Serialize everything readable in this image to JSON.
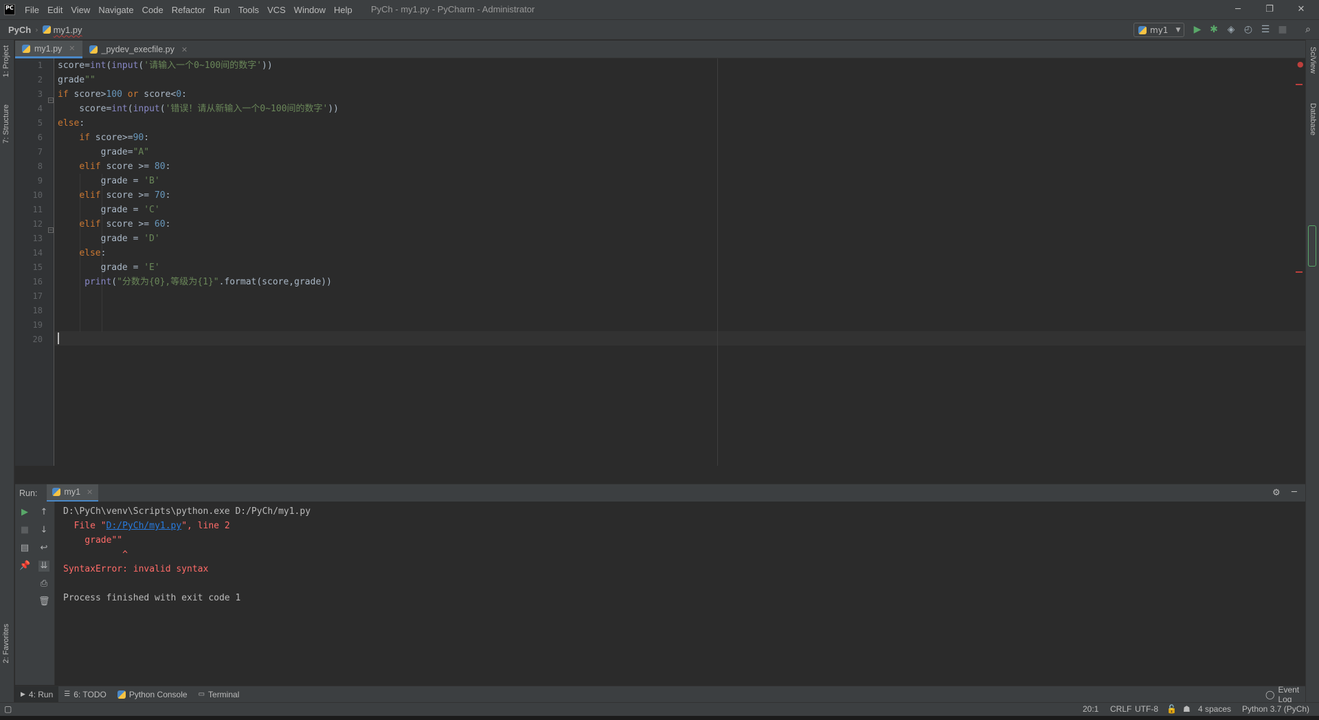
{
  "app": {
    "logo_text": "PC",
    "window_title": "PyCh - my1.py - PyCharm - Administrator"
  },
  "menu": [
    "File",
    "Edit",
    "View",
    "Navigate",
    "Code",
    "Refactor",
    "Run",
    "Tools",
    "VCS",
    "Window",
    "Help"
  ],
  "breadcrumb": {
    "project": "PyCh",
    "file": "my1.py"
  },
  "run_config": {
    "name": "my1"
  },
  "left_tabs": {
    "project": "1: Project",
    "structure": "7: Structure",
    "favorites": "2: Favorites"
  },
  "right_tabs": {
    "sciview": "SciView",
    "database": "Database"
  },
  "editor_tabs": [
    {
      "label": "my1.py",
      "active": true
    },
    {
      "label": "_pydev_execfile.py",
      "active": false
    }
  ],
  "editor": {
    "line_numbers": [
      "1",
      "2",
      "3",
      "4",
      "5",
      "6",
      "7",
      "8",
      "9",
      "10",
      "11",
      "12",
      "13",
      "14",
      "15",
      "16",
      "17",
      "18",
      "19",
      "20"
    ],
    "lines": [
      [
        [
          "",
          "score="
        ],
        [
          "bi",
          "int"
        ],
        [
          "",
          "("
        ],
        [
          "bi",
          "input"
        ],
        [
          "",
          "("
        ],
        [
          "str",
          "'请输入一个0~100间的数字'"
        ],
        [
          "",
          "))"
        ]
      ],
      [
        [
          "",
          "grade"
        ],
        [
          "str",
          "\"\""
        ]
      ],
      [
        [
          "kw",
          "if"
        ],
        [
          "",
          " score>"
        ],
        [
          "num",
          "100"
        ],
        [
          "",
          " "
        ],
        [
          "kw",
          "or"
        ],
        [
          "",
          " score<"
        ],
        [
          "num",
          "0"
        ],
        [
          "",
          ":"
        ]
      ],
      [
        [
          "",
          "    score="
        ],
        [
          "bi",
          "int"
        ],
        [
          "",
          "("
        ],
        [
          "bi",
          "input"
        ],
        [
          "",
          "("
        ],
        [
          "str",
          "'错误！请从新输入一个0~100间的数字'"
        ],
        [
          "",
          "))"
        ]
      ],
      [
        [
          "kw",
          "else"
        ],
        [
          "",
          ":"
        ]
      ],
      [
        [
          "",
          "    "
        ],
        [
          "kw",
          "if"
        ],
        [
          "",
          " score>="
        ],
        [
          "num",
          "90"
        ],
        [
          "",
          ":"
        ]
      ],
      [
        [
          "",
          "        grade="
        ],
        [
          "str",
          "\"A\""
        ]
      ],
      [
        [
          "",
          "    "
        ],
        [
          "kw",
          "elif"
        ],
        [
          "",
          " score >= "
        ],
        [
          "num",
          "80"
        ],
        [
          "",
          ":"
        ]
      ],
      [
        [
          "",
          "        grade = "
        ],
        [
          "str",
          "'B'"
        ]
      ],
      [
        [
          "",
          "    "
        ],
        [
          "kw",
          "elif"
        ],
        [
          "",
          " score >= "
        ],
        [
          "num",
          "70"
        ],
        [
          "",
          ":"
        ]
      ],
      [
        [
          "",
          "        grade = "
        ],
        [
          "str",
          "'C'"
        ]
      ],
      [
        [
          "",
          "    "
        ],
        [
          "kw",
          "elif"
        ],
        [
          "",
          " score >= "
        ],
        [
          "num",
          "60"
        ],
        [
          "",
          ":"
        ]
      ],
      [
        [
          "",
          "        grade = "
        ],
        [
          "str",
          "'D'"
        ]
      ],
      [
        [
          "",
          "    "
        ],
        [
          "kw",
          "else"
        ],
        [
          "",
          ":"
        ]
      ],
      [
        [
          "",
          "        grade = "
        ],
        [
          "str",
          "'E'"
        ]
      ],
      [
        [
          "",
          "     "
        ],
        [
          "bi",
          "print"
        ],
        [
          "",
          "("
        ],
        [
          "str",
          "\"分数为{0},等级为{1}\""
        ],
        [
          "",
          ".format(score,grade))"
        ]
      ],
      [],
      [],
      [],
      []
    ]
  },
  "run_panel": {
    "label": "Run:",
    "tab": "my1",
    "console": [
      {
        "type": "plain",
        "text": "D:\\PyCh\\venv\\Scripts\\python.exe D:/PyCh/my1.py"
      },
      {
        "type": "link-line",
        "before": "  File \"",
        "link": "D:/PyCh/my1.py",
        "after": "\", line 2"
      },
      {
        "type": "err",
        "text": "    grade\"\""
      },
      {
        "type": "err",
        "text": "           ^"
      },
      {
        "type": "err",
        "text": "SyntaxError: invalid syntax"
      },
      {
        "type": "plain",
        "text": ""
      },
      {
        "type": "plain",
        "text": "Process finished with exit code 1"
      }
    ]
  },
  "bottom_tabs": [
    "4: Run",
    "6: TODO",
    "Python Console",
    "Terminal"
  ],
  "event_log": "Event Log",
  "status": {
    "position": "20:1",
    "line_sep": "CRLF",
    "encoding": "UTF-8",
    "indent": "4 spaces",
    "interpreter": "Python 3.7 (PyCh)"
  },
  "colors": {
    "keyword": "#cc7832",
    "string": "#6a8759",
    "number": "#6897bb",
    "builtin": "#8888c6",
    "error": "#ff6b68",
    "accent": "#4a88c7"
  }
}
